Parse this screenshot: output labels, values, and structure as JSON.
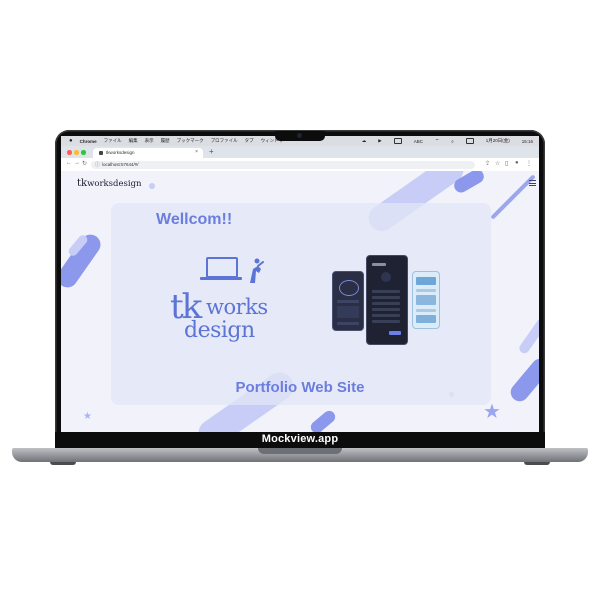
{
  "mockup": {
    "brand_text": "Mockview.app"
  },
  "menubar": {
    "apple_icon": "",
    "app_name": "Chrome",
    "items": [
      "ファイル",
      "編集",
      "表示",
      "履歴",
      "ブックマーク",
      "プロファイル",
      "タブ",
      "ウィンドウ"
    ],
    "status": {
      "input": "ABC",
      "date": "1月20日(金)",
      "time": "15:16"
    }
  },
  "browser": {
    "tab_title": "tkworksdesign",
    "new_tab_icon": "+",
    "url": "localhost:57644/#/"
  },
  "site": {
    "logo_tk": "tk",
    "logo_rest": "worksdesign",
    "welcome": "Wellcom!!",
    "tagline": "Portfolio Web Site",
    "big_logo": {
      "tk": "tk",
      "works": "works",
      "design": "design"
    }
  },
  "colors": {
    "accent": "#6b7ee0",
    "logo_blue": "#5c74d6",
    "blob_light": "#c7cdf6",
    "blob_mid": "#9aa6ee",
    "page_bg": "#f2f2fb",
    "phone_dark": "#2a2f45",
    "phone_light": "#dcebf8"
  }
}
